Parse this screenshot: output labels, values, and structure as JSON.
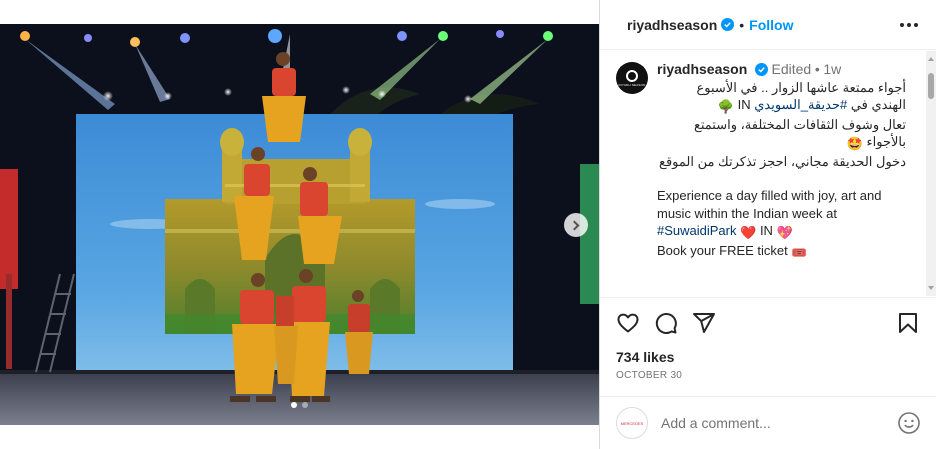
{
  "post": {
    "username": "riyadhseason",
    "follow_label": "Follow",
    "separator": "•",
    "edited_label": "Edited",
    "time_ago": "1w",
    "caption_ar_line1": "أجواء ممتعة عاشها الزوار .. في الأسبوع",
    "caption_ar_line2_prefix": "الهندي في",
    "caption_ar_hashtag": "#حديقة_السويدي",
    "caption_ar_in": "IN",
    "caption_ar_line3": "تعال وشوف الثقافات المختلفة، واستمتع بالأجواء",
    "caption_ar_line4": "دخول الحديقة مجاني، احجز تذكرتك من الموقع",
    "caption_en_line1": "Experience a day filled with joy, art and music within the Indian week at",
    "caption_en_hashtag": "#SuwaidiPark",
    "caption_en_in": "IN",
    "caption_en_line2": "Book your FREE ticket",
    "avatar_text": "RIYADH SEASON",
    "likes": "734 likes",
    "date": "OCTOBER 30"
  },
  "comment": {
    "placeholder": "Add a comment...",
    "avatar_text": "MERCEDES"
  },
  "carousel": {
    "slide_count": 2,
    "active_index": 0
  },
  "icons": {
    "verified": "verified-badge-icon",
    "more": "more-options-icon",
    "like": "heart-icon",
    "comment": "comment-icon",
    "share": "share-icon",
    "save": "bookmark-icon",
    "emoji": "smiley-icon",
    "next": "chevron-right-icon"
  },
  "colors": {
    "link_blue": "#0095f6",
    "hashtag": "#00376b",
    "muted": "#737373"
  }
}
